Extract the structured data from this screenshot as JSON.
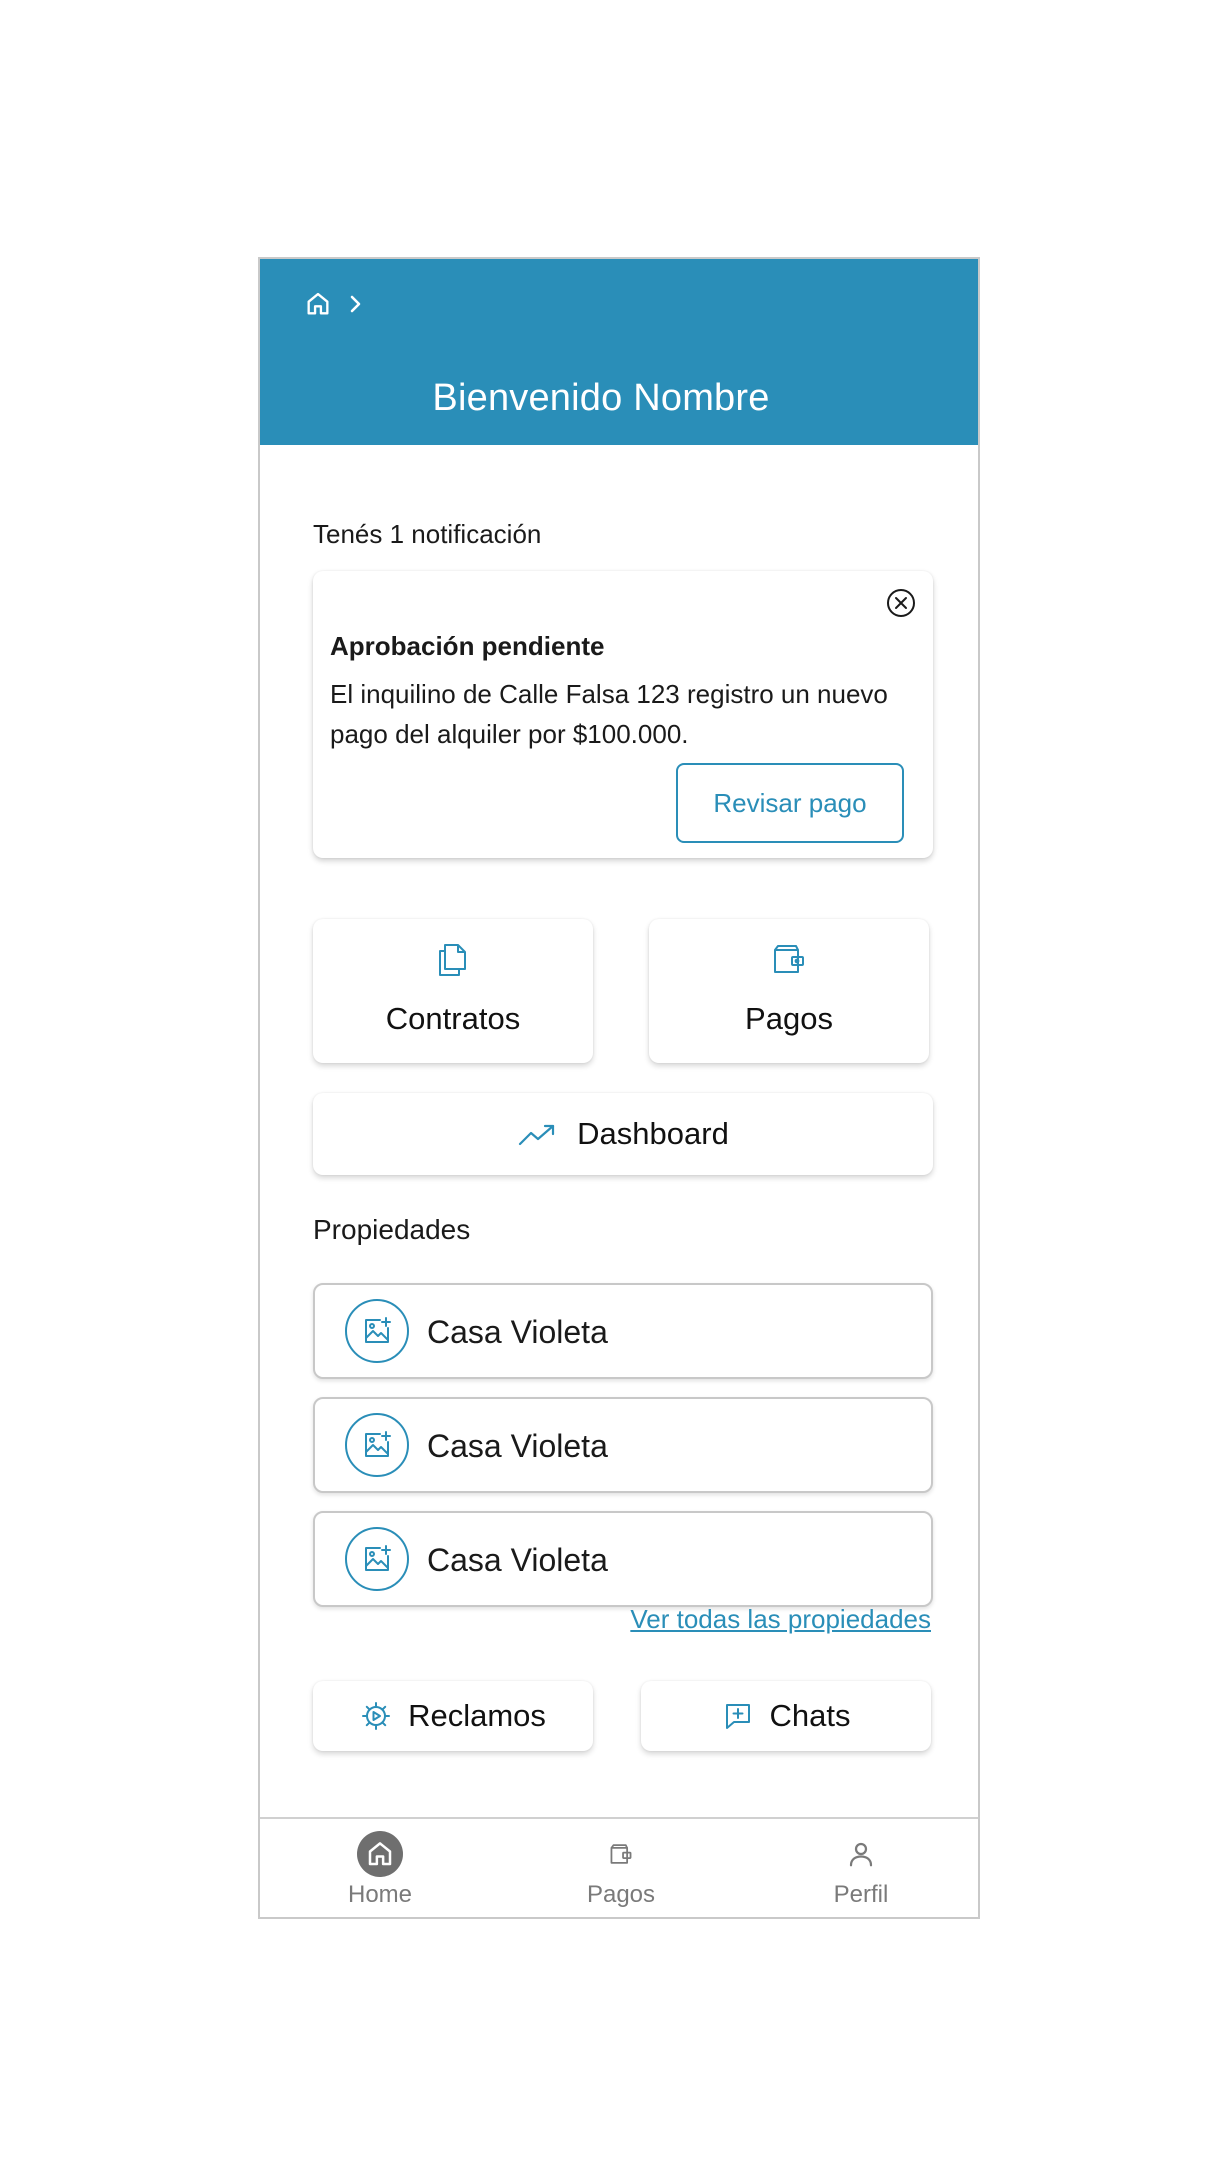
{
  "header": {
    "title": "Bienvenido Nombre",
    "breadcrumb_home_icon": "home-icon",
    "breadcrumb_separator_icon": "chevron-right-icon",
    "background": "#2a8eb8"
  },
  "notifications": {
    "count_text": "Tenés 1 notificación",
    "card": {
      "title": "Aprobación pendiente",
      "body": "El inquilino de Calle Falsa 123 registro un nuevo pago del alquiler por $100.000.",
      "action_label": "Revisar pago",
      "close_icon": "close-circle-icon"
    }
  },
  "shortcuts": {
    "contratos": {
      "label": "Contratos",
      "icon": "documents-icon"
    },
    "pagos": {
      "label": "Pagos",
      "icon": "wallet-icon"
    },
    "dashboard": {
      "label": "Dashboard",
      "icon": "trending-up-icon"
    }
  },
  "properties": {
    "title": "Propiedades",
    "items": [
      {
        "name": "Casa Violeta",
        "icon": "add-image-icon"
      },
      {
        "name": "Casa Violeta",
        "icon": "add-image-icon"
      },
      {
        "name": "Casa Violeta",
        "icon": "add-image-icon"
      }
    ],
    "see_all_label": "Ver todas las propiedades"
  },
  "secondary": {
    "reclamos": {
      "label": "Reclamos",
      "icon": "gear-icon"
    },
    "chats": {
      "label": "Chats",
      "icon": "chat-add-icon"
    }
  },
  "bottom_nav": {
    "items": [
      {
        "label": "Home",
        "icon": "home-icon",
        "active": true
      },
      {
        "label": "Pagos",
        "icon": "wallet-icon",
        "active": false
      },
      {
        "label": "Perfil",
        "icon": "user-icon",
        "active": false
      }
    ]
  },
  "colors": {
    "accent": "#2a8eb8",
    "nav_inactive": "#7a7a7a",
    "nav_active_bg": "#6f6f6f"
  }
}
